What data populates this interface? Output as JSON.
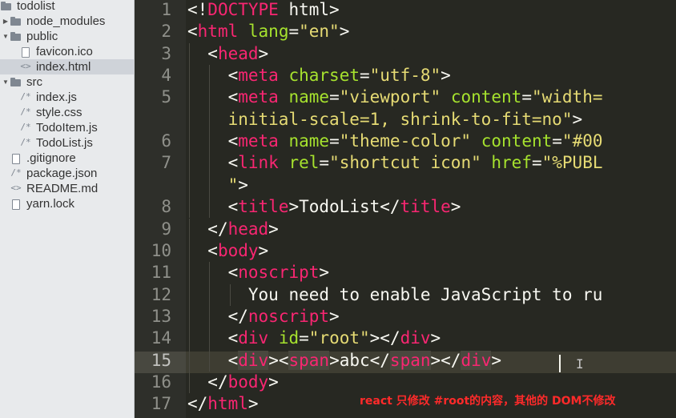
{
  "file_tree": [
    {
      "name": "todolist",
      "type": "folder",
      "expanded": true,
      "depth": 0
    },
    {
      "name": "node_modules",
      "type": "folder",
      "expanded": false,
      "depth": 1
    },
    {
      "name": "public",
      "type": "folder",
      "expanded": true,
      "depth": 1
    },
    {
      "name": "favicon.ico",
      "type": "image",
      "depth": 2
    },
    {
      "name": "index.html",
      "type": "markup",
      "depth": 2,
      "selected": true
    },
    {
      "name": "src",
      "type": "folder",
      "expanded": true,
      "depth": 1
    },
    {
      "name": "index.js",
      "type": "script",
      "depth": 2
    },
    {
      "name": "style.css",
      "type": "script",
      "depth": 2
    },
    {
      "name": "TodoItem.js",
      "type": "script",
      "depth": 2
    },
    {
      "name": "TodoList.js",
      "type": "script",
      "depth": 2
    },
    {
      "name": ".gitignore",
      "type": "file",
      "depth": 1
    },
    {
      "name": "package.json",
      "type": "script",
      "depth": 1
    },
    {
      "name": "README.md",
      "type": "markup",
      "depth": 1
    },
    {
      "name": "yarn.lock",
      "type": "file",
      "depth": 1
    }
  ],
  "editor": {
    "current_line": 15,
    "lines": [
      {
        "n": "1",
        "indent": 0,
        "tokens": [
          [
            "p",
            "<!"
          ],
          [
            "t",
            "DOCTYPE"
          ],
          [
            "p",
            " html>"
          ]
        ]
      },
      {
        "n": "2",
        "indent": 0,
        "tokens": [
          [
            "p",
            "<"
          ],
          [
            "t",
            "html"
          ],
          [
            "p",
            " "
          ],
          [
            "a",
            "lang"
          ],
          [
            "p",
            "="
          ],
          [
            "s",
            "\"en\""
          ],
          [
            "p",
            ">"
          ]
        ]
      },
      {
        "n": "3",
        "indent": 1,
        "tokens": [
          [
            "p",
            "<"
          ],
          [
            "t",
            "head"
          ],
          [
            "p",
            ">"
          ]
        ]
      },
      {
        "n": "4",
        "indent": 2,
        "tokens": [
          [
            "p",
            "<"
          ],
          [
            "t",
            "meta"
          ],
          [
            "p",
            " "
          ],
          [
            "a",
            "charset"
          ],
          [
            "p",
            "="
          ],
          [
            "s",
            "\"utf-8\""
          ],
          [
            "p",
            ">"
          ]
        ]
      },
      {
        "n": "5",
        "indent": 2,
        "tokens": [
          [
            "p",
            "<"
          ],
          [
            "t",
            "meta"
          ],
          [
            "p",
            " "
          ],
          [
            "a",
            "name"
          ],
          [
            "p",
            "="
          ],
          [
            "s",
            "\"viewport\""
          ],
          [
            "p",
            " "
          ],
          [
            "a",
            "content"
          ],
          [
            "p",
            "="
          ],
          [
            "s",
            "\"width="
          ]
        ]
      },
      {
        "n": "",
        "indent": 2,
        "tokens": [
          [
            "s",
            "initial-scale=1, shrink-to-fit=no\""
          ],
          [
            "p",
            ">"
          ]
        ]
      },
      {
        "n": "6",
        "indent": 2,
        "tokens": [
          [
            "p",
            "<"
          ],
          [
            "t",
            "meta"
          ],
          [
            "p",
            " "
          ],
          [
            "a",
            "name"
          ],
          [
            "p",
            "="
          ],
          [
            "s",
            "\"theme-color\""
          ],
          [
            "p",
            " "
          ],
          [
            "a",
            "content"
          ],
          [
            "p",
            "="
          ],
          [
            "s",
            "\"#00"
          ]
        ]
      },
      {
        "n": "7",
        "indent": 2,
        "tokens": [
          [
            "p",
            "<"
          ],
          [
            "t",
            "link"
          ],
          [
            "p",
            " "
          ],
          [
            "a",
            "rel"
          ],
          [
            "p",
            "="
          ],
          [
            "s",
            "\"shortcut icon\""
          ],
          [
            "p",
            " "
          ],
          [
            "a",
            "href"
          ],
          [
            "p",
            "="
          ],
          [
            "s",
            "\"%PUBL"
          ]
        ]
      },
      {
        "n": "",
        "indent": 2,
        "tokens": [
          [
            "s",
            "\""
          ],
          [
            "p",
            ">"
          ]
        ]
      },
      {
        "n": "8",
        "indent": 2,
        "tokens": [
          [
            "p",
            "<"
          ],
          [
            "t",
            "title"
          ],
          [
            "p",
            ">TodoList</"
          ],
          [
            "t",
            "title"
          ],
          [
            "p",
            ">"
          ]
        ]
      },
      {
        "n": "9",
        "indent": 1,
        "tokens": [
          [
            "p",
            "</"
          ],
          [
            "t",
            "head"
          ],
          [
            "p",
            ">"
          ]
        ]
      },
      {
        "n": "10",
        "indent": 1,
        "tokens": [
          [
            "p",
            "<"
          ],
          [
            "t",
            "body"
          ],
          [
            "p",
            ">"
          ]
        ]
      },
      {
        "n": "11",
        "indent": 2,
        "tokens": [
          [
            "p",
            "<"
          ],
          [
            "t",
            "noscript"
          ],
          [
            "p",
            ">"
          ]
        ]
      },
      {
        "n": "12",
        "indent": 3,
        "tokens": [
          [
            "p",
            "You need to enable JavaScript to ru"
          ]
        ]
      },
      {
        "n": "13",
        "indent": 2,
        "tokens": [
          [
            "p",
            "</"
          ],
          [
            "t",
            "noscript"
          ],
          [
            "p",
            ">"
          ]
        ]
      },
      {
        "n": "14",
        "indent": 2,
        "tokens": [
          [
            "p",
            "<"
          ],
          [
            "t",
            "div"
          ],
          [
            "p",
            " "
          ],
          [
            "a",
            "id"
          ],
          [
            "p",
            "="
          ],
          [
            "s",
            "\"root\""
          ],
          [
            "p",
            "></"
          ],
          [
            "t",
            "div"
          ],
          [
            "p",
            ">"
          ]
        ]
      },
      {
        "n": "15",
        "indent": 2,
        "tokens": [
          [
            "p",
            "<"
          ],
          [
            "th",
            "div"
          ],
          [
            "p",
            "><"
          ],
          [
            "th",
            "span"
          ],
          [
            "p",
            ">abc</"
          ],
          [
            "th",
            "span"
          ],
          [
            "p",
            "></"
          ],
          [
            "th",
            "div"
          ],
          [
            "p",
            ">"
          ]
        ]
      },
      {
        "n": "16",
        "indent": 1,
        "tokens": [
          [
            "p",
            "</"
          ],
          [
            "t",
            "body"
          ],
          [
            "p",
            ">"
          ]
        ]
      },
      {
        "n": "17",
        "indent": 0,
        "tokens": [
          [
            "p",
            "</"
          ],
          [
            "t",
            "html"
          ],
          [
            "p",
            ">"
          ]
        ]
      }
    ]
  },
  "annotation": "react 只修改 #root的内容，其他的 DOM不修改",
  "colors": {
    "background": "#272822",
    "tag": "#f92672",
    "attribute": "#a6e22e",
    "string": "#e6db74",
    "text": "#f8f8f2",
    "annotation": "#ff2a2a"
  }
}
